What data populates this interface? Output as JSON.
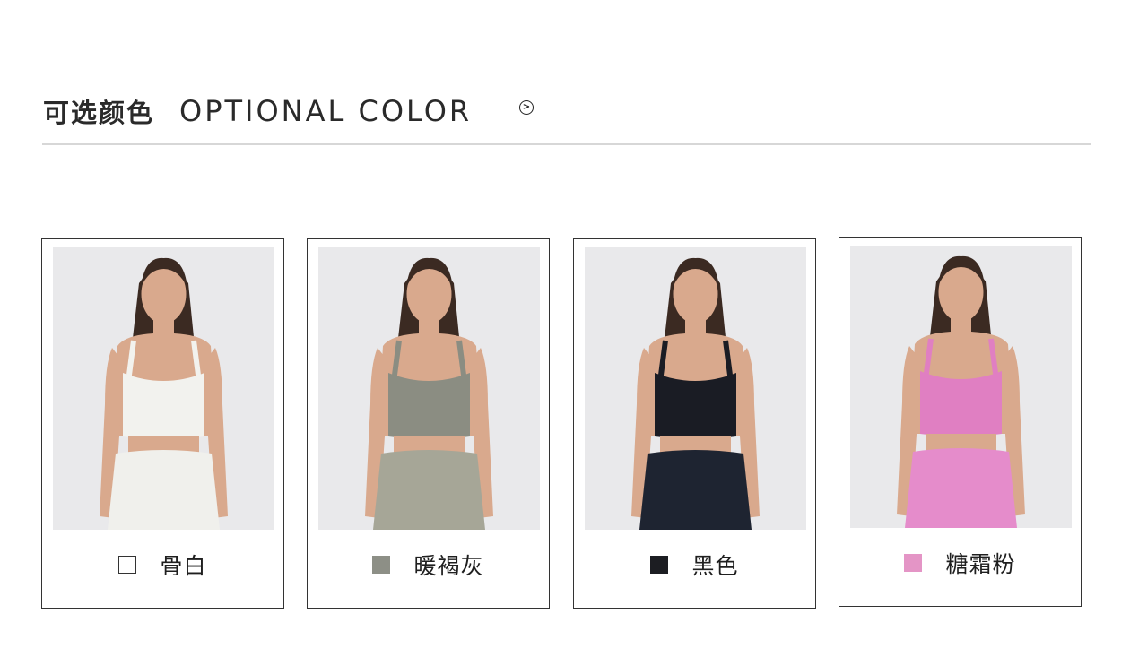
{
  "header": {
    "title_cn": "可选颜色",
    "title_en": "OPTIONAL COLOR",
    "arrow_icon": "circle-arrow-right-icon"
  },
  "colors": [
    {
      "name": "骨白",
      "swatch": "#ffffff",
      "swatch_border": "#333333",
      "top_color": "#f2f2ee",
      "bottom_color": "#f0f0ec"
    },
    {
      "name": "暖褐灰",
      "swatch": "#8d8f86",
      "swatch_border": "#8d8f86",
      "top_color": "#8b8d82",
      "bottom_color": "#a6a697"
    },
    {
      "name": "黑色",
      "swatch": "#1c1d22",
      "swatch_border": "#1c1d22",
      "top_color": "#1a1c24",
      "bottom_color": "#1e2431"
    },
    {
      "name": "糖霜粉",
      "swatch": "#e495c6",
      "swatch_border": "#e495c6",
      "top_color": "#e07fc2",
      "bottom_color": "#e58ccb"
    }
  ],
  "skin_color": "#d9a98d",
  "hair_color": "#3b2a22",
  "photo_bg": "#e9e9eb"
}
